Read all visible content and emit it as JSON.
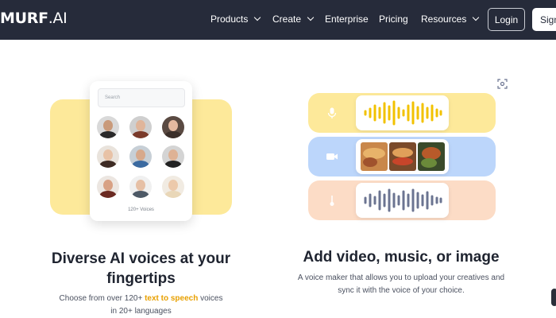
{
  "nav": {
    "logo": "MURF",
    "logo_suffix": ".AI",
    "items": [
      {
        "label": "Products",
        "dropdown": true
      },
      {
        "label": "Create",
        "dropdown": true
      },
      {
        "label": "Enterprise",
        "dropdown": false
      },
      {
        "label": "Pricing",
        "dropdown": false
      },
      {
        "label": "Resources",
        "dropdown": true
      }
    ],
    "login_label": "Login",
    "signup_label": "Sign"
  },
  "voices_card": {
    "search_placeholder": "Search",
    "count_label": "120+ Voices"
  },
  "feature_left": {
    "title_line1": "Diverse AI voices at your",
    "title_line2": "fingertips",
    "desc_prefix": "Choose from over 120+ ",
    "desc_link": "text to speech",
    "desc_suffix": " voices",
    "desc_line2": "in 20+ languages"
  },
  "feature_right": {
    "title": "Add video, music, or image",
    "desc_line1": "A voice maker that allows you to upload your creatives and",
    "desc_line2": "sync it with the voice of your choice."
  },
  "media_rows": [
    {
      "type": "voice",
      "icon": "microphone-icon",
      "color": "#fde99a",
      "wave_color": "#f2c200"
    },
    {
      "type": "video",
      "icon": "video-camera-icon",
      "color": "#bcd6fb"
    },
    {
      "type": "music",
      "icon": "music-note-icon",
      "color": "#fcdcc6",
      "wave_color": "#6b7491"
    }
  ],
  "colors": {
    "nav_bg": "#262b3a",
    "accent": "#e8a000"
  }
}
